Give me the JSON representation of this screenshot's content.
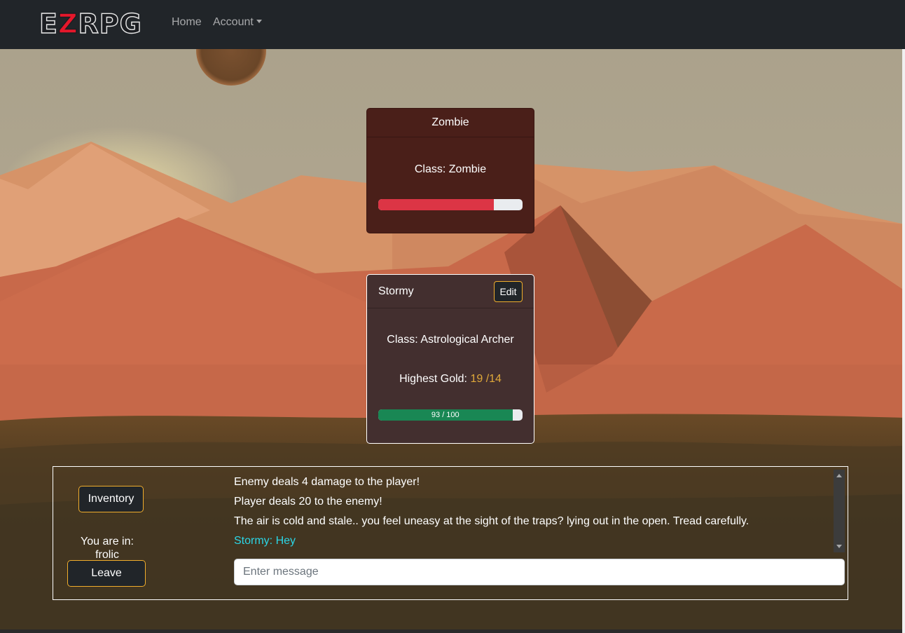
{
  "navbar": {
    "brand_e": "E",
    "brand_z": "Z",
    "brand_rest": "RPG",
    "home": "Home",
    "account": "Account"
  },
  "enemy": {
    "name": "Zombie",
    "class_label": "Class: Zombie",
    "health_fraction": 0.8
  },
  "player": {
    "name": "Stormy",
    "edit_label": "Edit",
    "class_label": "Class: Astrological Archer",
    "gold_label": "Highest Gold:",
    "gold_value": "19 /14",
    "health_text": "93 / 100",
    "health_fraction": 0.93
  },
  "panel": {
    "inventory_label": "Inventory",
    "room_prefix": "You are in:",
    "room_name": "frolic",
    "leave_label": "Leave",
    "log": [
      {
        "text": "Enemy deals 4 damage to the player!",
        "type": "system"
      },
      {
        "text": "Player deals 20 to the enemy!",
        "type": "system"
      },
      {
        "text": "The air is cold and stale.. you feel uneasy at the sight of the traps? lying out in the open. Tread carefully.",
        "type": "system"
      },
      {
        "text": "Stormy: Hey",
        "type": "chat"
      }
    ],
    "message_placeholder": "Enter message"
  },
  "colors": {
    "navbar": "#212529",
    "accent_border": "#f0ad2c",
    "enemy_bar": "#dc3545",
    "player_bar": "#198754",
    "gold": "#e0a93a",
    "chat": "#2bd6e6"
  }
}
